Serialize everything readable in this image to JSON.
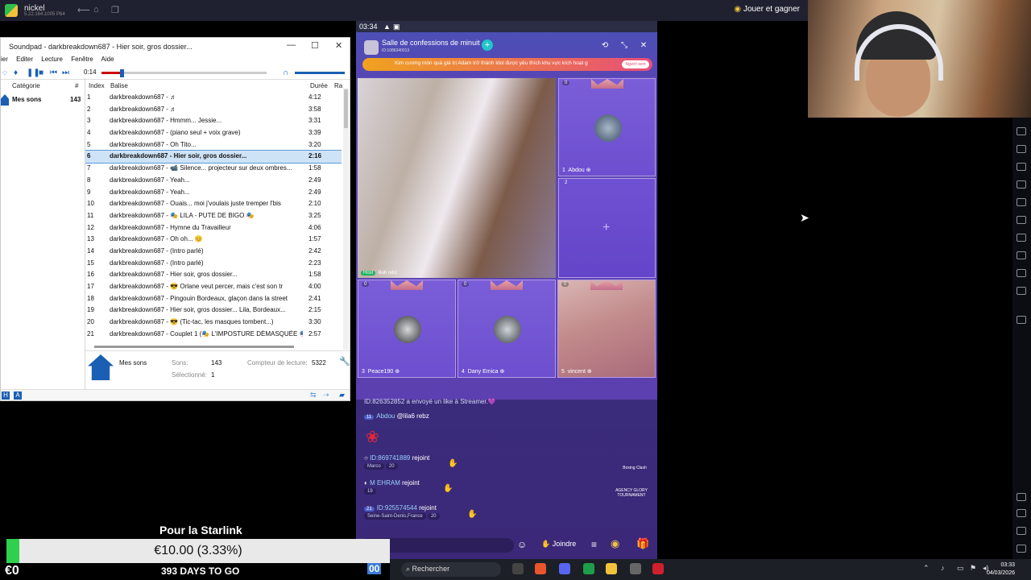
{
  "emulator": {
    "app_name": "nickel",
    "version": "5.22.164.1005 P64",
    "reward_label": "Jouer et gagner"
  },
  "soundpad": {
    "title": "Soundpad - darkbreakdown687 - Hier soir, gros dossier...",
    "menu": [
      "ier",
      "Editer",
      "Lecture",
      "Fenêtre",
      "Aide"
    ],
    "time": "0:14",
    "progress_fraction": 0.11,
    "category_header": "Catégorie",
    "hash_header": "#",
    "category": {
      "name": "Mes sons",
      "count": "143"
    },
    "columns": {
      "index": "Index",
      "tag": "Balise",
      "duration": "Durée",
      "ra": "Ra"
    },
    "tracks": [
      {
        "i": "1",
        "t": "darkbreakdown687 - ♬",
        "d": "4:12"
      },
      {
        "i": "2",
        "t": "darkbreakdown687 - ♬",
        "d": "3:58"
      },
      {
        "i": "3",
        "t": "darkbreakdown687 - Hmmm... Jessie...",
        "d": "3:31"
      },
      {
        "i": "4",
        "t": "darkbreakdown687 - (piano seul + voix grave)",
        "d": "3:39"
      },
      {
        "i": "5",
        "t": "darkbreakdown687 - Oh Tito...",
        "d": "3:20"
      },
      {
        "i": "6",
        "t": "darkbreakdown687 - Hier soir, gros dossier...",
        "d": "2:16",
        "selected": true
      },
      {
        "i": "7",
        "t": "darkbreakdown687 - 📹 Silence... projecteur sur deux ombres...",
        "d": "1:58"
      },
      {
        "i": "8",
        "t": "darkbreakdown687 - Yeah...",
        "d": "2:49"
      },
      {
        "i": "9",
        "t": "darkbreakdown687 - Yeah...",
        "d": "2:49"
      },
      {
        "i": "10",
        "t": "darkbreakdown687 - Ouais... moi j'voulais juste tremper l'bis",
        "d": "2:10"
      },
      {
        "i": "11",
        "t": "darkbreakdown687 - 🎭 LILA - PUTE DE BIGO 🎭",
        "d": "3:25"
      },
      {
        "i": "12",
        "t": "darkbreakdown687 - Hymne du Travailleur",
        "d": "4:06"
      },
      {
        "i": "13",
        "t": "darkbreakdown687 - Oh oh... 😊",
        "d": "1:57"
      },
      {
        "i": "14",
        "t": "darkbreakdown687 - (Intro parlé)",
        "d": "2:42"
      },
      {
        "i": "15",
        "t": "darkbreakdown687 - (Intro parlé)",
        "d": "2:23"
      },
      {
        "i": "16",
        "t": "darkbreakdown687 - Hier soir, gros dossier...",
        "d": "1:58"
      },
      {
        "i": "17",
        "t": "darkbreakdown687 - 😎 Orlane veut percer, mais c'est son tr",
        "d": "4:00"
      },
      {
        "i": "18",
        "t": "darkbreakdown687 - Pingouin Bordeaux, glaçon dans la street",
        "d": "2:41"
      },
      {
        "i": "19",
        "t": "darkbreakdown687 - Hier soir, gros dossier... Lila, Bordeaux...",
        "d": "2:15"
      },
      {
        "i": "20",
        "t": "darkbreakdown687 - 😎 (Tic-tac, les masques tombent...)",
        "d": "3:30"
      },
      {
        "i": "21",
        "t": "darkbreakdown687 - Couplet 1 (🎭 L'IMPOSTURE DÉMASQUÉE 🎭)",
        "d": "2:57"
      }
    ],
    "footer": {
      "folder": "Mes sons",
      "sons_label": "Sons:",
      "sons": "143",
      "sel_label": "Sélectionné:",
      "sel": "1",
      "counter_label": "Compteur de lecture:",
      "counter": "5322"
    }
  },
  "phone": {
    "clock": "03:34",
    "room_title": "Salle de confessions de minuit",
    "room_id": "ID:1086340013",
    "ticker": "Kim cương món quà giá trị Adam trở thành Idol được yêu thích khu vực kích hoạt g",
    "ticker_btn": "Người xem",
    "host_label": "Host",
    "host_name": "lila6 rebz",
    "seats": [
      {
        "n": "1",
        "name": "Abdou",
        "score": "0"
      },
      {
        "n": "3",
        "name": "Peace190",
        "score": "0"
      },
      {
        "n": "4",
        "name": "Dany Emica",
        "score": "0"
      },
      {
        "n": "5",
        "name": "vincent",
        "score": "0"
      }
    ],
    "empty_seat": "2",
    "chat": {
      "l1": "ID:826352852 a envoyé un like à Streamer.💜",
      "l2_lvl": "11",
      "l2_name": "Abdou",
      "l2_msg": "@lila6 rebz",
      "l3_id": "ID:869741889",
      "l3_act": "rejoint",
      "l3_loc": "Marco",
      "l3_n": "20",
      "l4_name": "M EHRAM",
      "l4_act": "rejoint",
      "l4_n": "19",
      "l5_lvl": "21",
      "l5_id": "ID:925574544",
      "l5_act": "rejoint",
      "l5_loc": "Seine-Saint-Denis,France",
      "l5_n": "20"
    },
    "say": "Salut...",
    "joindre": "Joindre",
    "boxing": "Boxing Clash",
    "agency": "AGENCY GLORY TOURNAMENT"
  },
  "overlay": {
    "goal_title": "Pour la Starlink",
    "amount": "€10.00 (3.33%)",
    "progress_percent": 3.33,
    "raised": "€0",
    "days": "393 DAYS TO GO",
    "partial_number": "00"
  },
  "taskbar": {
    "search": "Rechercher",
    "time": "03:33",
    "date": "04/03/2026"
  }
}
